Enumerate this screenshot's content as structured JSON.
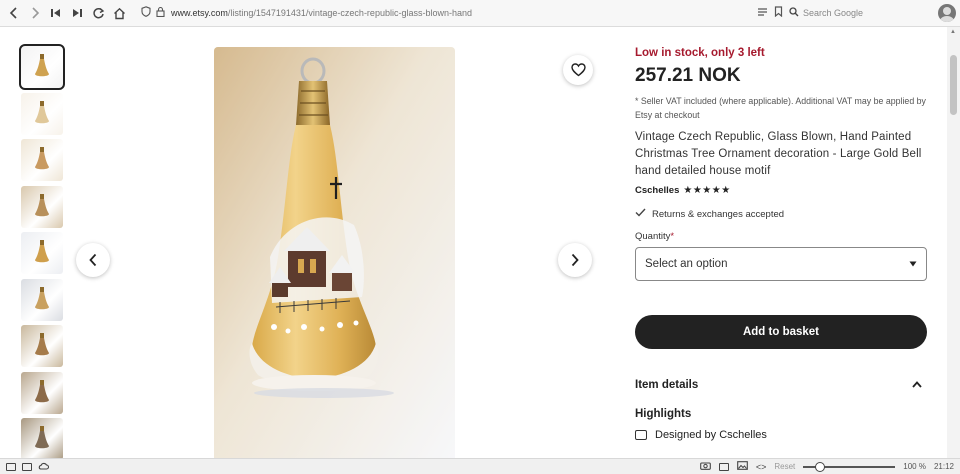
{
  "browser": {
    "url_host": "www.etsy.com",
    "url_path": "/listing/1547191431/vintage-czech-republic-glass-blown-hand",
    "search_placeholder": "Search Google"
  },
  "listing": {
    "stock_status": "Low in stock, only 3 left",
    "price": "257.21 NOK",
    "vat_note": "* Seller VAT included (where applicable). Additional VAT may be applied by Etsy at checkout",
    "title": "Vintage Czech Republic, Glass Blown, Hand Painted Christmas Tree Ornament decoration - Large Gold Bell hand detailed house motif",
    "seller": "Cschelles",
    "rating_stars": "★★★★★",
    "returns": "Returns & exchanges accepted",
    "quantity_label": "Quantity",
    "quantity_required": "*",
    "select_placeholder": "Select an option",
    "add_to_basket": "Add to basket",
    "item_details": "Item details",
    "highlights": "Highlights",
    "designed_by": "Designed by Cschelles"
  },
  "thumbnails": [
    {
      "color": "#cfa250",
      "bg": "#f3f3f3"
    },
    {
      "color": "#e0c89a",
      "bg": "#f7f2ea"
    },
    {
      "color": "#c99a60",
      "bg": "#efe6d6"
    },
    {
      "color": "#b8905a",
      "bg": "#d9c8ad"
    },
    {
      "color": "#cf9f4c",
      "bg": "#eceef2"
    },
    {
      "color": "#c9a160",
      "bg": "#dadde2"
    },
    {
      "color": "#a57b4a",
      "bg": "#c9b89c"
    },
    {
      "color": "#8c6a48",
      "bg": "#b9a78e"
    },
    {
      "color": "#7f6b55",
      "bg": "#a89880"
    }
  ],
  "statusbar": {
    "reset": "Reset",
    "zoom": "100 %",
    "time": "21:12"
  },
  "colors": {
    "stock_red": "#a61a2e",
    "button_dark": "#222222"
  }
}
